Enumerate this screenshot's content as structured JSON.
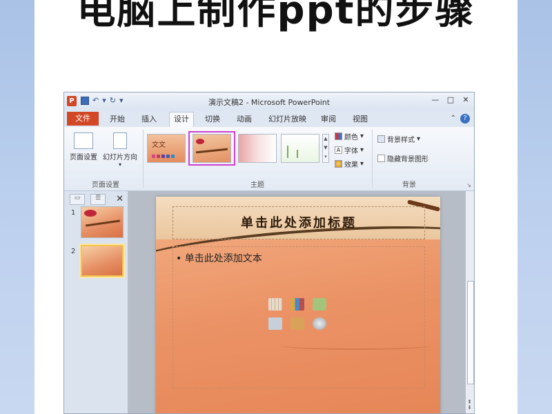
{
  "banner": {
    "title": "电脑上制作ppt的步骤"
  },
  "window": {
    "title": "演示文稿2 - Microsoft PowerPoint",
    "app_icon_label": "P",
    "controls": [
      "—",
      "□",
      "✕"
    ]
  },
  "tabs": {
    "file": "文件",
    "items": [
      "开始",
      "插入",
      "设计",
      "切换",
      "动画",
      "幻灯片放映",
      "审阅",
      "视图"
    ],
    "active": "设计",
    "help": "?"
  },
  "ribbon": {
    "page_setup": {
      "label": "页面设置",
      "buttons": [
        "页面设置",
        "幻灯片方向"
      ]
    },
    "themes": {
      "label": "主题",
      "first_theme_text": "文文",
      "options": {
        "colors": "颜色",
        "fonts": "字体",
        "effects": "效果"
      }
    },
    "background": {
      "label": "背景",
      "style": "背景样式",
      "hide": "隐藏背景图形"
    }
  },
  "panel": {
    "close": "✕",
    "slides": [
      {
        "num": "1"
      },
      {
        "num": "2"
      }
    ]
  },
  "slide": {
    "title_placeholder": "单击此处添加标题",
    "body_placeholder": "单击此处添加文本",
    "bullet": "•"
  },
  "colors": {
    "file_tab": "#d24726",
    "selection": "#cf3fcf",
    "slide_orange": "#eb9366"
  }
}
